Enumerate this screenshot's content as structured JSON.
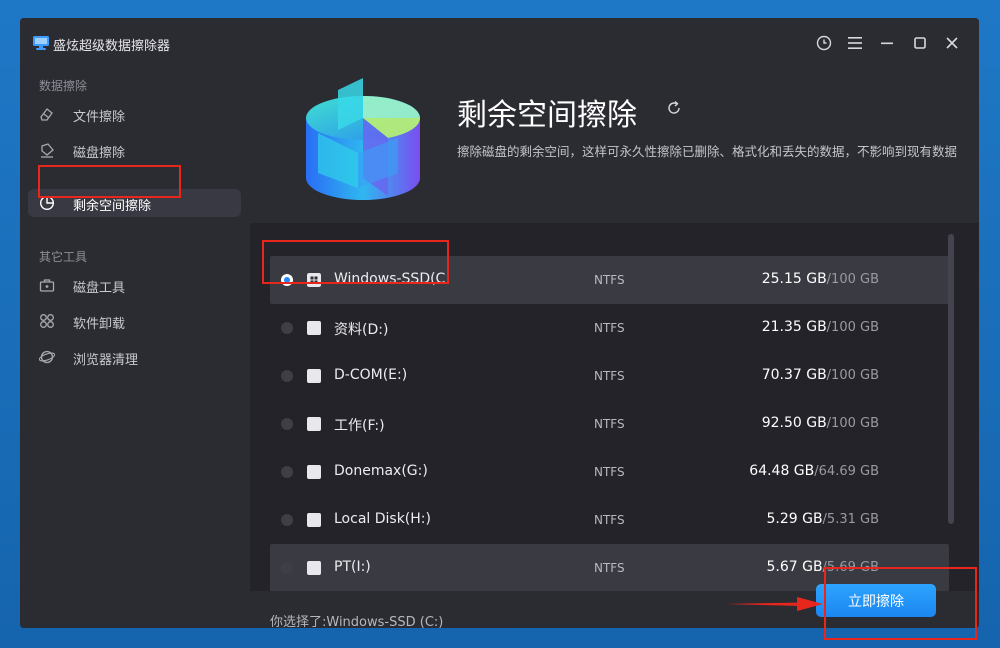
{
  "app": {
    "title": "盛炫超级数据擦除器"
  },
  "sidebar": {
    "section1_label": "数据擦除",
    "section2_label": "其它工具",
    "items": [
      {
        "label": "文件擦除"
      },
      {
        "label": "磁盘擦除"
      },
      {
        "label": "剩余空间擦除"
      },
      {
        "label": "磁盘工具"
      },
      {
        "label": "软件卸载"
      },
      {
        "label": "浏览器清理"
      }
    ]
  },
  "main": {
    "title": "剩余空间擦除",
    "description": "擦除磁盘的剩余空间，这样可永久性擦除已删除、格式化和丢失的数据，不影响到现有数据"
  },
  "drives": [
    {
      "name": "Windows-SSD(C:",
      "fs": "NTFS",
      "used": "25.15 GB",
      "total": "/100 GB"
    },
    {
      "name": "资料(D:)",
      "fs": "NTFS",
      "used": "21.35 GB",
      "total": "/100 GB"
    },
    {
      "name": "D-COM(E:)",
      "fs": "NTFS",
      "used": "70.37 GB",
      "total": "/100 GB"
    },
    {
      "name": "工作(F:)",
      "fs": "NTFS",
      "used": "92.50 GB",
      "total": "/100 GB"
    },
    {
      "name": "Donemax(G:)",
      "fs": "NTFS",
      "used": "64.48 GB",
      "total": "/64.69 GB"
    },
    {
      "name": "Local Disk(H:)",
      "fs": "NTFS",
      "used": "5.29 GB",
      "total": "/5.31 GB"
    },
    {
      "name": "PT(I:)",
      "fs": "NTFS",
      "used": "5.67 GB",
      "total": "/5.69 GB"
    }
  ],
  "footer": {
    "selected_text": "你选择了:Windows-SSD (C:)",
    "erase_button": "立即擦除"
  },
  "colors": {
    "accent": "#1e88ff",
    "annotation": "#e8271c"
  }
}
